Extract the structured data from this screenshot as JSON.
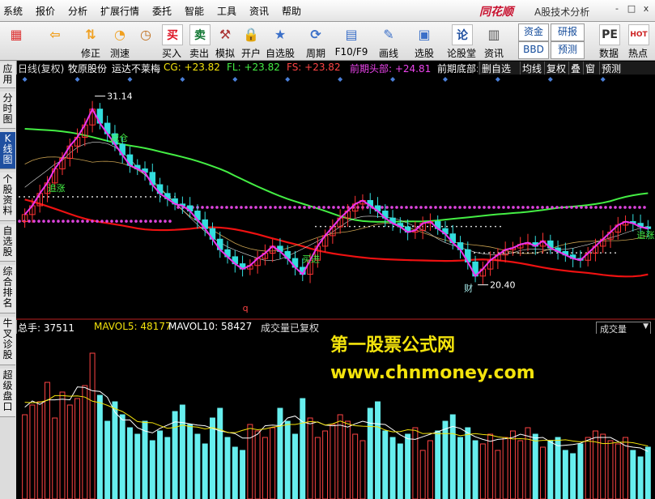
{
  "menu": [
    "系统",
    "报价",
    "分析",
    "扩展行情",
    "委托",
    "智能",
    "工具",
    "资讯",
    "帮助"
  ],
  "brand": {
    "logo": "同花顺",
    "subtitle": "A股技术分析"
  },
  "window_controls": [
    "-",
    "□",
    "x"
  ],
  "toolbar": [
    {
      "label": "",
      "icon": "grid-icon",
      "color": "#d33"
    },
    {
      "label": "",
      "icon": "back-arrow-icon",
      "color": "#f0a020"
    },
    {
      "label": "修正",
      "icon": "up-down-icon",
      "color": "#f0a020"
    },
    {
      "label": "测速",
      "icon": "speed-icon",
      "color": "#f0a020"
    },
    {
      "label": "",
      "icon": "clock-icon",
      "color": "#c07020"
    },
    {
      "label": "买入",
      "text": "买",
      "color": "#d12"
    },
    {
      "label": "卖出",
      "text": "卖",
      "color": "#173"
    },
    {
      "label": "模拟",
      "icon": "hammer-icon",
      "color": "#a33"
    },
    {
      "label": "开户",
      "icon": "lock-icon",
      "color": "#a70"
    },
    {
      "label": "自选股",
      "icon": "star-icon",
      "color": "#3a6fc8"
    },
    {
      "label": "周期",
      "icon": "cycle-icon",
      "color": "#3a6fc8"
    },
    {
      "label": "F10/F9",
      "icon": "f10-icon",
      "color": "#3a6fc8"
    },
    {
      "label": "画线",
      "icon": "pencil-icon",
      "color": "#3a6fc8"
    },
    {
      "label": "选股",
      "icon": "select-icon",
      "color": "#3a6fc8"
    },
    {
      "label": "论股堂",
      "text": "论",
      "color": "#1f4fa0"
    },
    {
      "label": "资讯",
      "icon": "news-icon",
      "color": "#555"
    },
    {
      "label": "数据",
      "text": "PE",
      "color": "#333"
    },
    {
      "label": "热点",
      "text": "HOT",
      "color": "#c22"
    }
  ],
  "toolbar_buttons": {
    "fund": "资金",
    "research": "研报",
    "bbd": "BBD",
    "forecast": "预测"
  },
  "sidebar": [
    {
      "label": "应用",
      "active": false
    },
    {
      "label": "分时图",
      "active": false
    },
    {
      "label": "K线图",
      "active": true
    },
    {
      "label": "个股资料",
      "active": false
    },
    {
      "label": "自选股",
      "active": false
    },
    {
      "label": "综合排名",
      "active": false
    },
    {
      "label": "牛叉诊股",
      "active": false
    },
    {
      "label": "超级盘口",
      "active": false
    }
  ],
  "info": {
    "period": "日线(复权)",
    "stock": "牧原股份",
    "indicator": "运达不莱梅",
    "cg": "CG: +23.82",
    "fl": "FL: +23.82",
    "fs": "FS: +23.82",
    "top": "前期头部: +24.81",
    "bottom": "前期底部:"
  },
  "chart_tabs": [
    "删自选",
    "均线",
    "复权",
    "叠",
    "窗",
    "预测"
  ],
  "vol_info": {
    "total": "总手: 37511",
    "mavol5": "MAVOL5: 48177",
    "mavol10": "MAVOL10: 58427",
    "note": "成交量已复权"
  },
  "selector": "成交量",
  "watermark": {
    "line1": "第一股票公式网",
    "line2": "www.chnmoney.com"
  },
  "colors": {
    "up": "#ff3333",
    "down": "#33dddd",
    "ma_green": "#44ee44",
    "ma_red": "#ee1111",
    "magenta": "#ee33ee",
    "dots": "#dd44dd",
    "vol_up": "#ff4444",
    "vol_down": "#66eeee"
  },
  "chart_data": [
    {
      "type": "candlestick",
      "title": "",
      "annotations": [
        {
          "text": "31.14",
          "kind": "high"
        },
        {
          "text": "20.40",
          "kind": "low"
        },
        {
          "text": "减仓",
          "kind": "signal"
        },
        {
          "text": "追涨",
          "kind": "signal"
        },
        {
          "text": "买进",
          "kind": "signal"
        },
        {
          "text": "追涨",
          "kind": "signal"
        },
        {
          "text": "财",
          "kind": "marker"
        },
        {
          "text": "q",
          "kind": "marker"
        }
      ],
      "levels": {
        "cg": 23.82,
        "fl": 23.82,
        "fs": 23.82,
        "prev_top": 24.81,
        "high": 31.14,
        "low": 20.4
      },
      "ylim": [
        19,
        32
      ],
      "closes": [
        24.4,
        24.9,
        25.6,
        26.2,
        27.0,
        27.6,
        28.3,
        28.8,
        29.5,
        30.4,
        29.6,
        29.0,
        28.4,
        27.8,
        27.2,
        27.0,
        26.8,
        26.1,
        25.6,
        25.3,
        25.0,
        24.9,
        24.6,
        24.1,
        23.6,
        23.0,
        22.4,
        22.0,
        21.6,
        21.3,
        21.5,
        21.9,
        22.2,
        22.6,
        22.3,
        21.9,
        21.4,
        21.0,
        21.8,
        22.6,
        23.2,
        23.7,
        24.2,
        24.6,
        25.0,
        25.2,
        24.9,
        24.6,
        24.2,
        23.9,
        23.7,
        23.4,
        23.5,
        23.9,
        24.0,
        23.6,
        23.3,
        22.8,
        22.4,
        21.7,
        20.9,
        21.3,
        21.8,
        22.1,
        22.4,
        22.5,
        22.7,
        22.8,
        22.6,
        22.9,
        22.5,
        22.3,
        22.1,
        21.9,
        21.8,
        22.2,
        22.6,
        23.0,
        23.4,
        23.8,
        24.0,
        23.9,
        23.7,
        23.6
      ]
    },
    {
      "type": "bar",
      "title": "",
      "ylabel": "",
      "series_names": [
        "MAVOL5",
        "MAVOL10"
      ],
      "volumes": [
        52,
        58,
        60,
        72,
        50,
        66,
        58,
        62,
        70,
        90,
        64,
        48,
        60,
        52,
        44,
        40,
        48,
        36,
        42,
        38,
        54,
        58,
        46,
        40,
        34,
        50,
        56,
        38,
        32,
        30,
        46,
        42,
        38,
        44,
        56,
        48,
        40,
        62,
        50,
        38,
        42,
        46,
        52,
        48,
        40,
        36,
        56,
        60,
        42,
        38,
        34,
        40,
        44,
        30,
        36,
        42,
        48,
        52,
        38,
        44,
        36,
        34,
        40,
        30,
        38,
        42,
        36,
        44,
        40,
        32,
        36,
        38,
        30,
        28,
        34,
        38,
        42,
        40,
        36,
        34,
        38,
        30,
        26,
        32
      ],
      "ylim": [
        0,
        100
      ]
    }
  ]
}
